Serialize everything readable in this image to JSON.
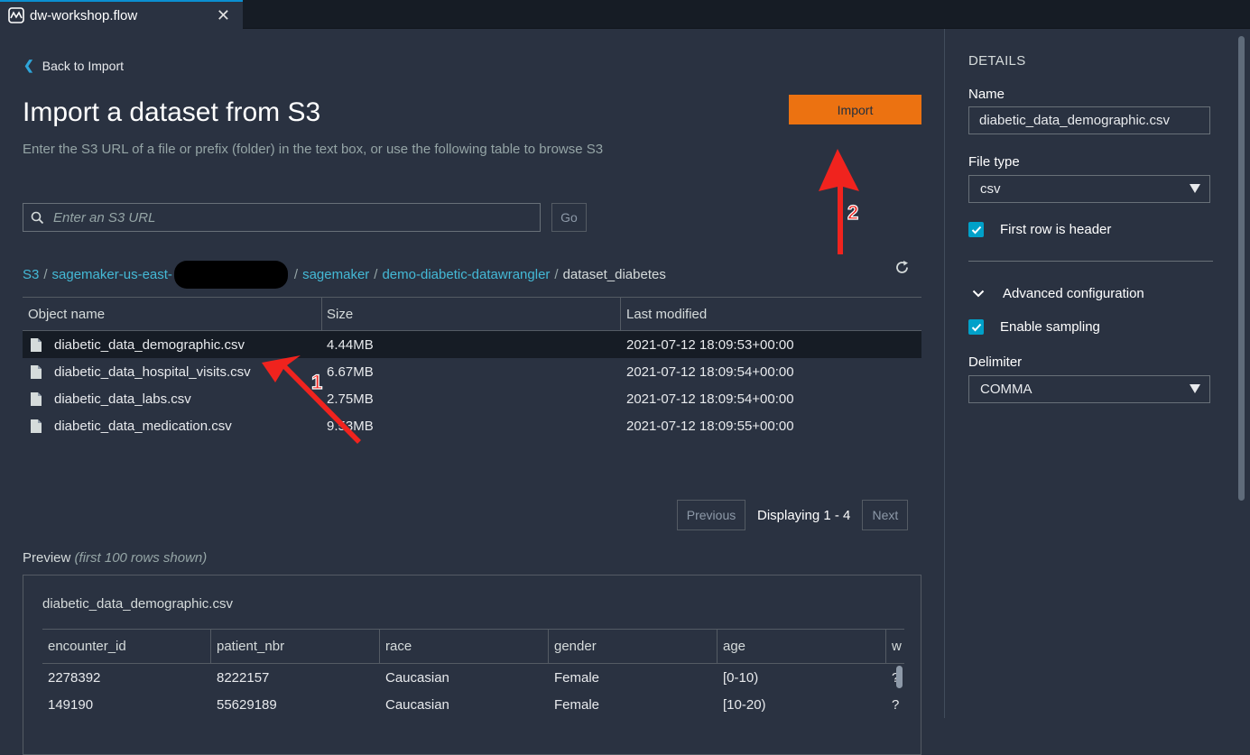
{
  "tab": {
    "title": "dw-workshop.flow",
    "close": "✕"
  },
  "nav": {
    "back_label": "Back to Import"
  },
  "header": {
    "title": "Import a dataset from S3",
    "subtitle": "Enter the S3 URL of a file or prefix (folder) in the text box, or use the following table to browse S3",
    "import_label": "Import"
  },
  "search": {
    "placeholder": "Enter an S3 URL",
    "value": "",
    "go_label": "Go"
  },
  "breadcrumb": {
    "s3": "S3",
    "bucket": "sagemaker-us-east-",
    "folder1": "sagemaker",
    "folder2": "demo-diabetic-datawrangler",
    "current": "dataset_diabetes",
    "separator": "/"
  },
  "table": {
    "headers": [
      "Object name",
      "Size",
      "Last modified"
    ],
    "rows": [
      {
        "name": "diabetic_data_demographic.csv",
        "size": "4.44MB",
        "modified": "2021-07-12 18:09:53+00:00",
        "selected": true
      },
      {
        "name": "diabetic_data_hospital_visits.csv",
        "size": "6.67MB",
        "modified": "2021-07-12 18:09:54+00:00",
        "selected": false
      },
      {
        "name": "diabetic_data_labs.csv",
        "size": "2.75MB",
        "modified": "2021-07-12 18:09:54+00:00",
        "selected": false
      },
      {
        "name": "diabetic_data_medication.csv",
        "size": "9.53MB",
        "modified": "2021-07-12 18:09:55+00:00",
        "selected": false
      }
    ]
  },
  "pager": {
    "previous": "Previous",
    "text": "Displaying 1 - 4",
    "next": "Next"
  },
  "preview": {
    "label": "Preview",
    "note": "(first 100 rows shown)",
    "file": "diabetic_data_demographic.csv",
    "headers": [
      "encounter_id",
      "patient_nbr",
      "race",
      "gender",
      "age",
      "w"
    ],
    "rows": [
      [
        "2278392",
        "8222157",
        "Caucasian",
        "Female",
        "[0-10)",
        "?"
      ],
      [
        "149190",
        "55629189",
        "Caucasian",
        "Female",
        "[10-20)",
        "?"
      ]
    ]
  },
  "details": {
    "heading": "DETAILS",
    "name_label": "Name",
    "name_value": "diabetic_data_demographic.csv",
    "filetype_label": "File type",
    "filetype_value": "csv",
    "first_row_header": "First row is header",
    "advanced": "Advanced configuration",
    "enable_sampling": "Enable sampling",
    "delimiter_label": "Delimiter",
    "delimiter_value": "COMMA"
  },
  "annotations": {
    "arrow1": "1",
    "arrow2": "2",
    "color": "#f0231e"
  },
  "colors": {
    "accent": "#ec7211",
    "link": "#44b9d6",
    "checkbox": "#00a1c9",
    "background": "#2a3241"
  }
}
